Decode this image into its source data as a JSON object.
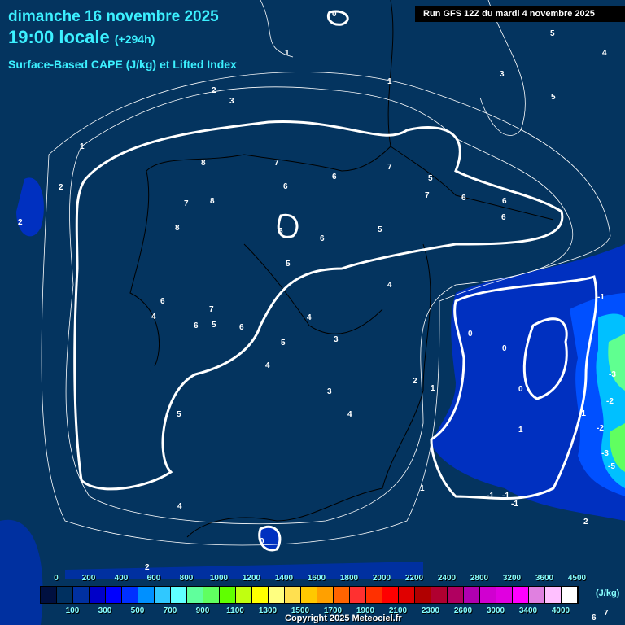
{
  "header": {
    "date": "dimanche 16 novembre 2025",
    "time": "19:00 locale",
    "lead": "(+294h)",
    "parameter": "Surface-Based CAPE (J/kg) et Lifted Index",
    "run": "Run GFS 12Z du mardi 4 novembre 2025"
  },
  "legend": {
    "unit": "(J/kg)",
    "colors": [
      "#001040",
      "#003060",
      "#0030a0",
      "#0000c8",
      "#0000ff",
      "#0030ff",
      "#0090ff",
      "#30c8ff",
      "#60ffff",
      "#60ff9c",
      "#60ff60",
      "#60ff00",
      "#c0ff10",
      "#ffff00",
      "#ffff80",
      "#ffe050",
      "#ffc800",
      "#ffa000",
      "#ff6400",
      "#ff3030",
      "#ff3000",
      "#ff0000",
      "#e00000",
      "#b00000",
      "#b00030",
      "#b00060",
      "#b000b0",
      "#d000d0",
      "#e000e0",
      "#ff00ff",
      "#e080e0",
      "#ffc0ff",
      "#ffffff"
    ],
    "labels": [
      "0",
      "100",
      "200",
      "300",
      "400",
      "500",
      "600",
      "700",
      "800",
      "900",
      "1000",
      "1100",
      "1200",
      "1300",
      "1400",
      "1500",
      "1600",
      "1700",
      "1800",
      "1900",
      "2000",
      "2100",
      "2200",
      "2300",
      "2400",
      "2600",
      "2800",
      "3000",
      "3200",
      "3400",
      "3600",
      "4000",
      "4500"
    ]
  },
  "contour_labels": [
    "0",
    "1",
    "5",
    "1",
    "3",
    "5",
    "4",
    "2",
    "3",
    "1",
    "2",
    "2",
    "8",
    "8",
    "7",
    "7",
    "8",
    "6",
    "6",
    "7",
    "6",
    "5",
    "6",
    "7",
    "6",
    "6",
    "5",
    "5",
    "5",
    "4",
    "6",
    "7",
    "6",
    "5",
    "6",
    "4",
    "5",
    "4",
    "3",
    "3",
    "2",
    "1",
    "4",
    "5",
    "4",
    "0",
    "1",
    "0",
    "0",
    "-1",
    "-3",
    "-2",
    "-1",
    "-2",
    "-3",
    "-5",
    "-1",
    "-1",
    "-1",
    "1",
    "2",
    "0",
    "2",
    "4",
    "6",
    "7"
  ],
  "copyright": "Copyright 2025 Meteociel.fr"
}
